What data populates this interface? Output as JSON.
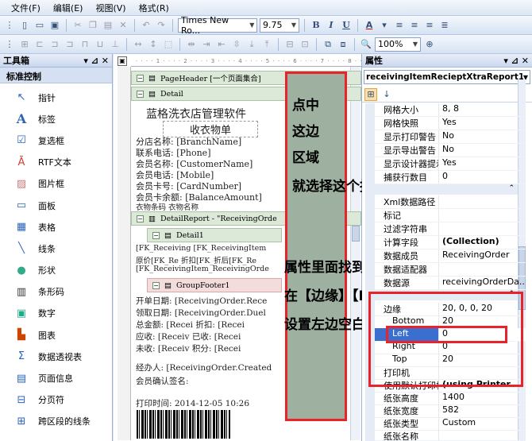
{
  "menu": [
    "文件(F)",
    "编辑(E)",
    "视图(V)",
    "格式(R)"
  ],
  "toolbar": {
    "font_name": "Times New Ro...",
    "font_size": "9.75",
    "bold": "B",
    "italic": "I",
    "underline": "U",
    "zoom": "100%"
  },
  "toolbox": {
    "title": "工具箱",
    "section": "标准控制",
    "items": [
      "指针",
      "标签",
      "复选框",
      "RTF文本",
      "图片框",
      "面板",
      "表格",
      "线条",
      "形状",
      "条形码",
      "数字",
      "图表",
      "数据透视表",
      "页面信息",
      "分页符",
      "跨区段的线条"
    ]
  },
  "design": {
    "bands": {
      "page_header": "PageHeader [一个页面集合]",
      "detail": "Detail",
      "detail_report": "DetailReport - \"ReceivingOrde",
      "detail1": "Detail1",
      "group_footer": "GroupFooter1"
    },
    "title": "蓝格洗衣店管理软件",
    "subtitle": "收衣物单",
    "lines": [
      "分店名称: [BranchName]",
      "联系电话: [Phone]",
      "会员名称: [CustomerName]",
      "会员电话: [Mobile]",
      "会员卡号: [CardNumber]",
      "会员卡余额: [BalanceAmount]",
      "衣物条码    衣物名称"
    ],
    "detail_lines": [
      "[FK_Receiving [FK_ReceivingItem",
      "原价[FK_Re 折扣[FK_折后[FK_Re",
      "[FK_ReceivingItem_ReceivingOrde"
    ],
    "footer_lines": [
      "开单日期: [ReceivingOrder.Rece",
      "领取日期: [ReceivingOrder.Duel",
      "总金额: [Recei 折扣: [Recei",
      "应收: [Receiv 已收: [Recei",
      "未收: [Receiv 积分: [Recei",
      "经办人: [ReceivingOrder.Created",
      "会员确认签名:",
      "打印时间: 2014-12-05 10:26"
    ]
  },
  "annotations": {
    "box1": [
      "点中",
      "这边",
      "区域",
      "就选择这个报表"
    ],
    "box2": [
      "属性里面找到【页面设置】",
      "在【边缘】【Left】里面",
      "设置左边空白长度"
    ]
  },
  "properties": {
    "title": "属性",
    "object": "receivingItemRecieptXtraReport1",
    "rows": [
      [
        "网格大小",
        "8, 8"
      ],
      [
        "网格快照",
        "Yes"
      ],
      [
        "显示打印警告",
        "No"
      ],
      [
        "显示导出警告",
        "No"
      ],
      [
        "显示设计器提示",
        "Yes"
      ],
      [
        "捕获行数目",
        "0"
      ]
    ],
    "rows2": [
      [
        "Xml数据路径",
        ""
      ],
      [
        "标记",
        ""
      ],
      [
        "过滤字符串",
        ""
      ],
      [
        "计算字段",
        "(Collection)"
      ],
      [
        "数据成员",
        "ReceivingOrder"
      ],
      [
        "数据适配器",
        ""
      ],
      [
        "数据源",
        "receivingOrderDa..."
      ]
    ],
    "margins": {
      "name": "边缘",
      "value": "20, 0, 0, 20",
      "bottom_name": "Bottom",
      "bottom": "20",
      "left_name": "Left",
      "left": "0",
      "right_name": "Right",
      "right": "0",
      "top_name": "Top",
      "top": "20"
    },
    "rows3": [
      [
        "打印机",
        ""
      ],
      [
        "使用默认打印机",
        "(using Printer ..."
      ],
      [
        "纸张高度",
        "1400"
      ],
      [
        "纸张宽度",
        "582"
      ],
      [
        "纸张类型",
        "Custom"
      ],
      [
        "纸张名称",
        ""
      ]
    ]
  }
}
